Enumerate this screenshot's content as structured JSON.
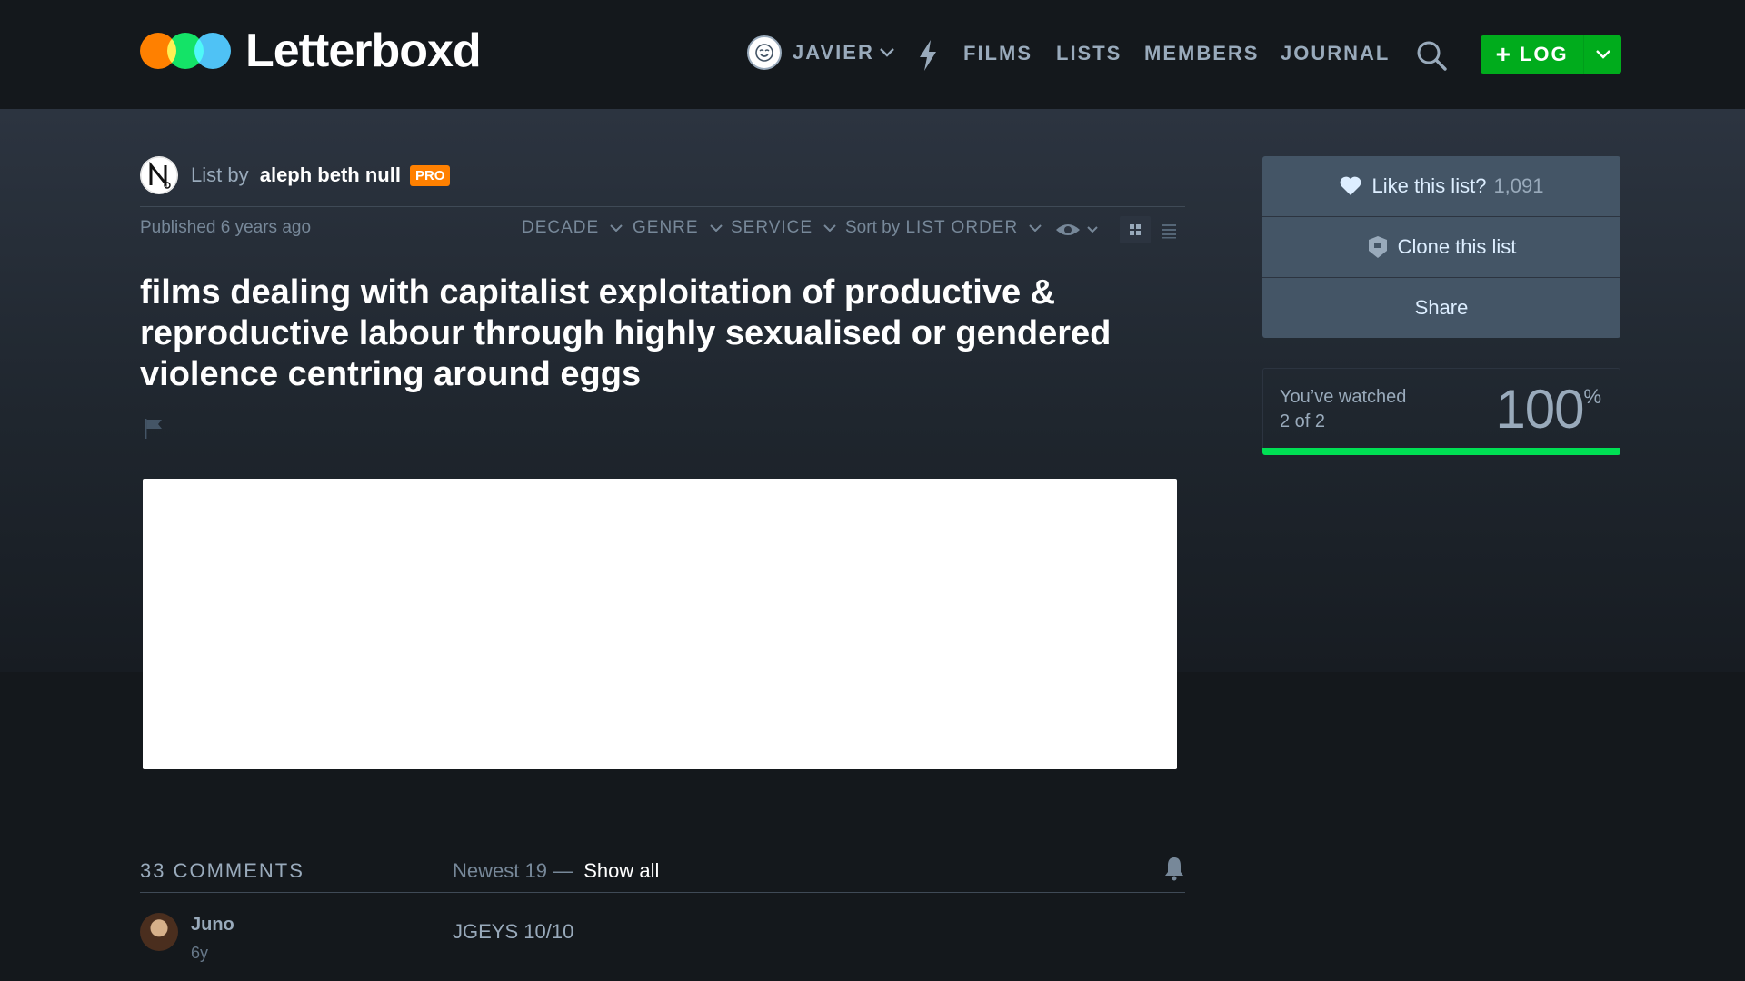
{
  "header": {
    "logo_text": "Letterboxd",
    "user": "JAVIER",
    "nav": {
      "films": "FILMS",
      "lists": "LISTS",
      "members": "MEMBERS",
      "journal": "JOURNAL"
    },
    "log_label": "LOG",
    "colors": {
      "orange": "#ff8000",
      "green": "#00e054",
      "blue": "#40bcf4",
      "log_button": "#00ac1c"
    }
  },
  "list": {
    "by_prefix": "List by",
    "owner": "aleph beth null",
    "badge": "PRO",
    "published": "Published 6 years ago",
    "filters": {
      "decade": "DECADE",
      "genre": "GENRE",
      "service": "SERVICE",
      "sort_prefix": "Sort by",
      "sort_value": "LIST ORDER"
    },
    "title": "films dealing with capitalist exploitation of productive & reproductive labour through highly sexualised or gendered violence centring around eggs"
  },
  "sidebar": {
    "like_label": "Like this list?",
    "like_count": "1,091",
    "clone_label": "Clone this list",
    "share_label": "Share",
    "watched_line1": "You’ve watched",
    "watched_line2": "2 of 2",
    "watched_percent": "100",
    "percent_sign": "%",
    "progress_fraction": 1.0
  },
  "comments": {
    "count_label": "33 COMMENTS",
    "filter_label": "Newest 19 —",
    "show_all": "Show all",
    "items": [
      {
        "name": "Juno",
        "age": "6y",
        "text": "JGEYS 10/10"
      }
    ]
  }
}
